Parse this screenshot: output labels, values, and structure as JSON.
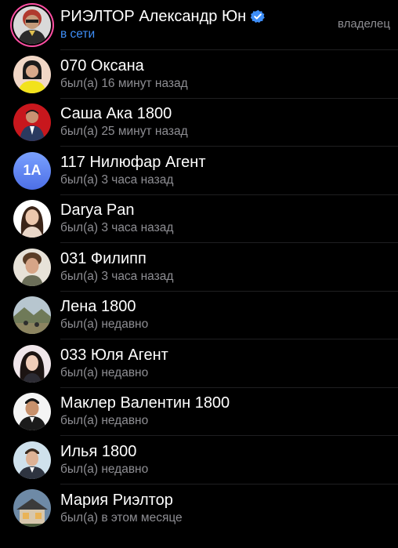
{
  "owner": {
    "name": "РИЭЛТОР Александр Юн",
    "status": "в сети",
    "role": "владелец",
    "avatar_icon": "person-photo-icon",
    "verified_icon": "verified-badge-icon"
  },
  "members": [
    {
      "name": "070 Оксана",
      "status": "был(а) 16 минут назад",
      "avatar_icon": "person-photo-icon"
    },
    {
      "name": "Саша Ака 1800",
      "status": "был(а) 25 минут назад",
      "avatar_icon": "person-photo-icon"
    },
    {
      "name": "117 Нилюфар Агент",
      "status": "был(а) 3 часа назад",
      "initials": "1A"
    },
    {
      "name": "Darya Pan",
      "status": "был(а) 3 часа назад",
      "avatar_icon": "person-photo-icon"
    },
    {
      "name": "031 Филипп",
      "status": "был(а) 3 часа назад",
      "avatar_icon": "person-photo-icon"
    },
    {
      "name": "Лена 1800",
      "status": "был(а) недавно",
      "avatar_icon": "landscape-photo-icon"
    },
    {
      "name": "033 Юля Агент",
      "status": "был(а) недавно",
      "avatar_icon": "person-photo-icon"
    },
    {
      "name": "Маклер Валентин 1800",
      "status": "был(а) недавно",
      "avatar_icon": "person-photo-icon"
    },
    {
      "name": "Илья 1800",
      "status": "был(а) недавно",
      "avatar_icon": "person-photo-icon"
    },
    {
      "name": "Мария Риэлтор",
      "status": "был(а) в этом месяце",
      "avatar_icon": "house-photo-icon"
    }
  ],
  "colors": {
    "background": "#000000",
    "name_text": "#ffffff",
    "status_text": "#8e8e93",
    "online_text": "#3e8ef7",
    "verified_badge": "#3e8ef7",
    "initials_avatar": "#5b7cf0"
  }
}
